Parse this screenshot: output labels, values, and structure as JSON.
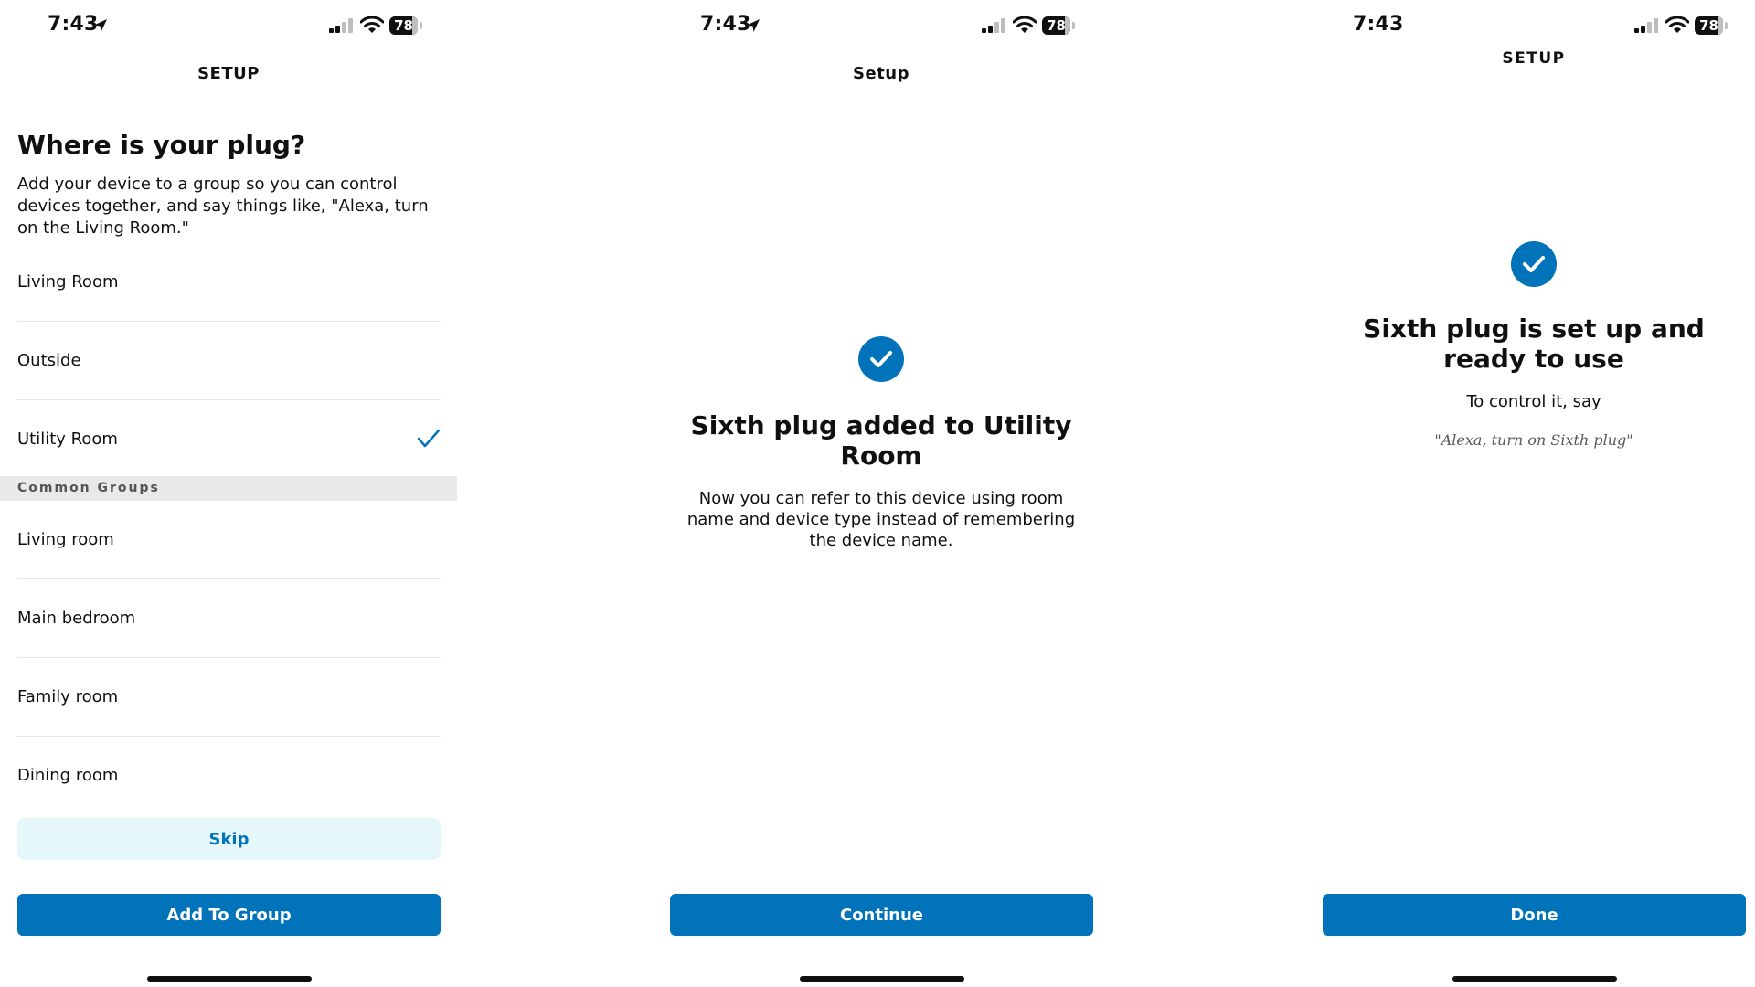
{
  "status_bar": {
    "time": "7:43",
    "battery": "78"
  },
  "screen1": {
    "nav_title": "SETUP",
    "heading": "Where is your plug?",
    "description": "Add your device to a group so you can control devices together, and say things like, \"Alexa, turn on the Living Room.\"",
    "rooms": [
      "Living Room",
      "Outside",
      "Utility Room"
    ],
    "selected_room": "Utility Room",
    "common_groups_header": "Common Groups",
    "common_groups": [
      "Living room",
      "Main bedroom",
      "Family room",
      "Dining room"
    ],
    "skip_label": "Skip",
    "add_label": "Add To Group"
  },
  "screen2": {
    "nav_title": "Setup",
    "title": "Sixth plug added to Utility Room",
    "body": "Now you can refer to this device using room name and device type instead of remembering the device name.",
    "button_label": "Continue"
  },
  "screen3": {
    "nav_title": "SETUP",
    "title": "Sixth plug is set up and ready to use",
    "subtitle": "To control it, say",
    "quote": "\"Alexa, turn on Sixth plug\"",
    "button_label": "Done"
  },
  "colors": {
    "accent": "#0073bb",
    "secondary_bg": "#e6f7fc",
    "section_bg": "#e9e9e9"
  },
  "icons": [
    "location-arrow-icon",
    "cellular-signal-icon",
    "wifi-icon",
    "battery-icon",
    "checkmark-icon",
    "check-circle-icon"
  ]
}
